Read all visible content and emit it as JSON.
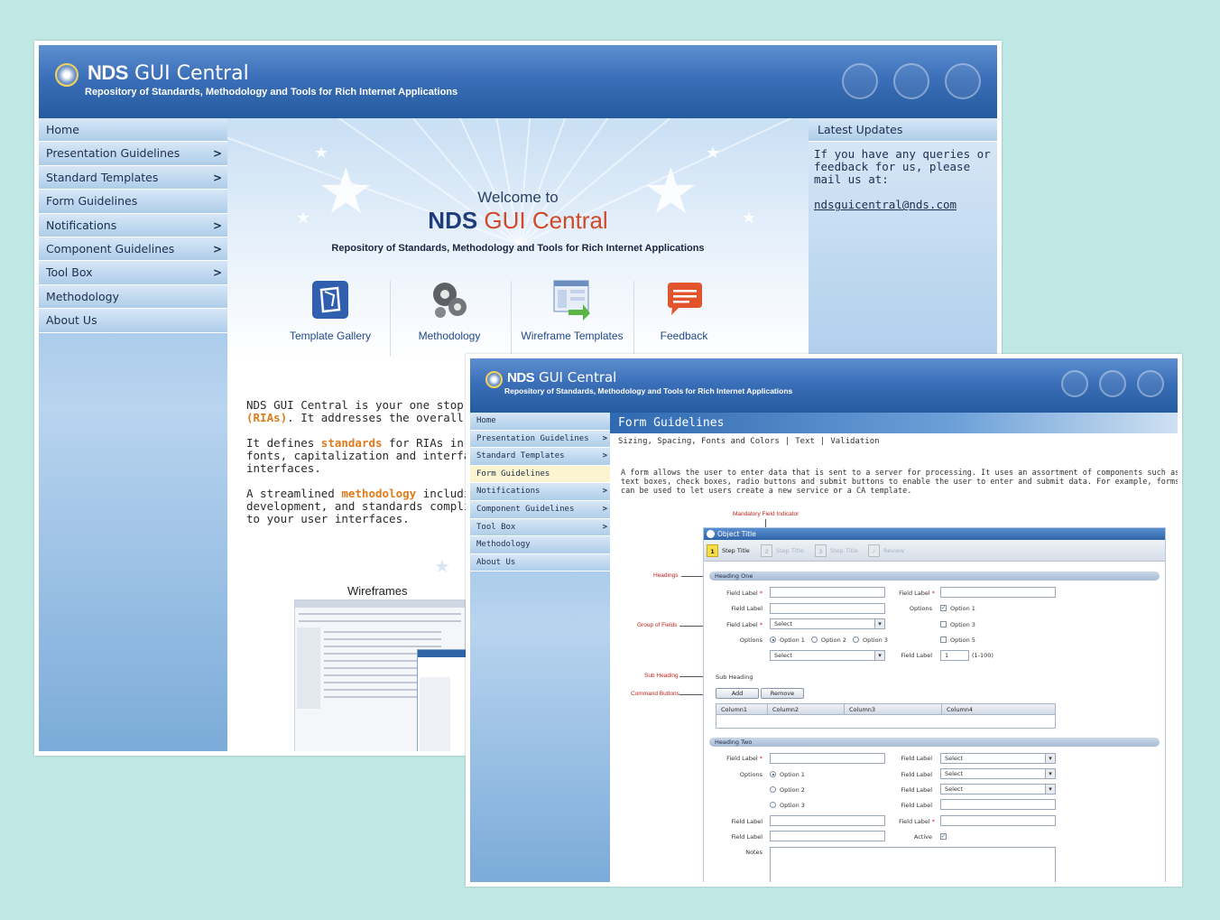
{
  "site": {
    "brand_strong": "NDS",
    "brand_rest": " GUI Central",
    "tagline": "Repository of Standards, Methodology and Tools for Rich Internet Applications"
  },
  "nav": {
    "items": [
      {
        "label": "Home",
        "arrow": ""
      },
      {
        "label": "Presentation Guidelines",
        "arrow": ">"
      },
      {
        "label": "Standard Templates",
        "arrow": ">"
      },
      {
        "label": "Form Guidelines",
        "arrow": ""
      },
      {
        "label": "Notifications",
        "arrow": ">"
      },
      {
        "label": "Component Guidelines",
        "arrow": ">"
      },
      {
        "label": "Tool Box",
        "arrow": ">"
      },
      {
        "label": "Methodology",
        "arrow": ""
      },
      {
        "label": "About Us",
        "arrow": ""
      }
    ]
  },
  "home": {
    "welcome": "Welcome to",
    "big_strong": "NDS",
    "big_rest": " GUI Central",
    "banner_tagline": "Repository of Standards, Methodology and Tools for Rich Internet Applications",
    "tiles": [
      {
        "label": "Template Gallery",
        "icon": "template-gallery-icon"
      },
      {
        "label": "Methodology",
        "icon": "gears-icon"
      },
      {
        "label": "Wireframe Templates",
        "icon": "wireframe-icon"
      },
      {
        "label": "Feedback",
        "icon": "speech-bubble-icon"
      }
    ],
    "updates_title": "Latest Updates",
    "updates_text": "If you have any queries or feedback for us, please mail us at:",
    "updates_email": "ndsguicentral@nds.com",
    "p1a": "NDS GUI Central is your one stop shop f",
    "p1b": "(RIAs)",
    "p1c": ". It addresses the overall design",
    "p2a": "It defines ",
    "p2b": "standards",
    "p2c": " for RIAs in terms",
    "p2d": "fonts, capitalization and interface contro",
    "p2e": "interfaces.",
    "p3a": "A streamlined ",
    "p3b": "methodology",
    "p3c": " including w",
    "p3d": "development, and standards compliance",
    "p3e": "to your user interfaces.",
    "wireframes_title": "Wireframes"
  },
  "forms_page": {
    "title": "Form Guidelines",
    "subnav": [
      "Sizing, Spacing, Fonts and Colors",
      "|",
      "Text",
      "|",
      "Validation"
    ],
    "intro": "A form allows the user to enter data that is sent to a server for processing. It uses an assortment of components such as text boxes, check boxes, radio buttons and submit buttons to enable the user to enter and submit data. For example, forms can be used to let users create a new service or a CA template.",
    "callouts": {
      "mandatory": "Mandatory Field Indicator",
      "headings": "Headings",
      "group": "Group of Fields",
      "subheading": "Sub Heading",
      "command": "Command Buttons"
    },
    "form": {
      "object_title": "Object Title",
      "steps": [
        {
          "num": "1",
          "label": "Step Title"
        },
        {
          "num": "2",
          "label": "Step Title"
        },
        {
          "num": "3",
          "label": "Step Title"
        },
        {
          "num": "",
          "label": "Review"
        }
      ],
      "heading_one": "Heading One",
      "heading_two": "Heading Two",
      "field_label": "Field Label",
      "req": "*",
      "options_label": "Options",
      "select_value": "Select",
      "option1": "Option 1",
      "option2": "Option 2",
      "option3": "Option 3",
      "option5": "Option 5",
      "stepper_value": "1",
      "stepper_range": "(1-100)",
      "sub_heading": "Sub Heading",
      "add_button": "Add",
      "remove_button": "Remove",
      "columns": [
        "Column1",
        "Column2",
        "Column3",
        "Column4"
      ],
      "active_label": "Active",
      "notes_label": "Notes"
    }
  }
}
